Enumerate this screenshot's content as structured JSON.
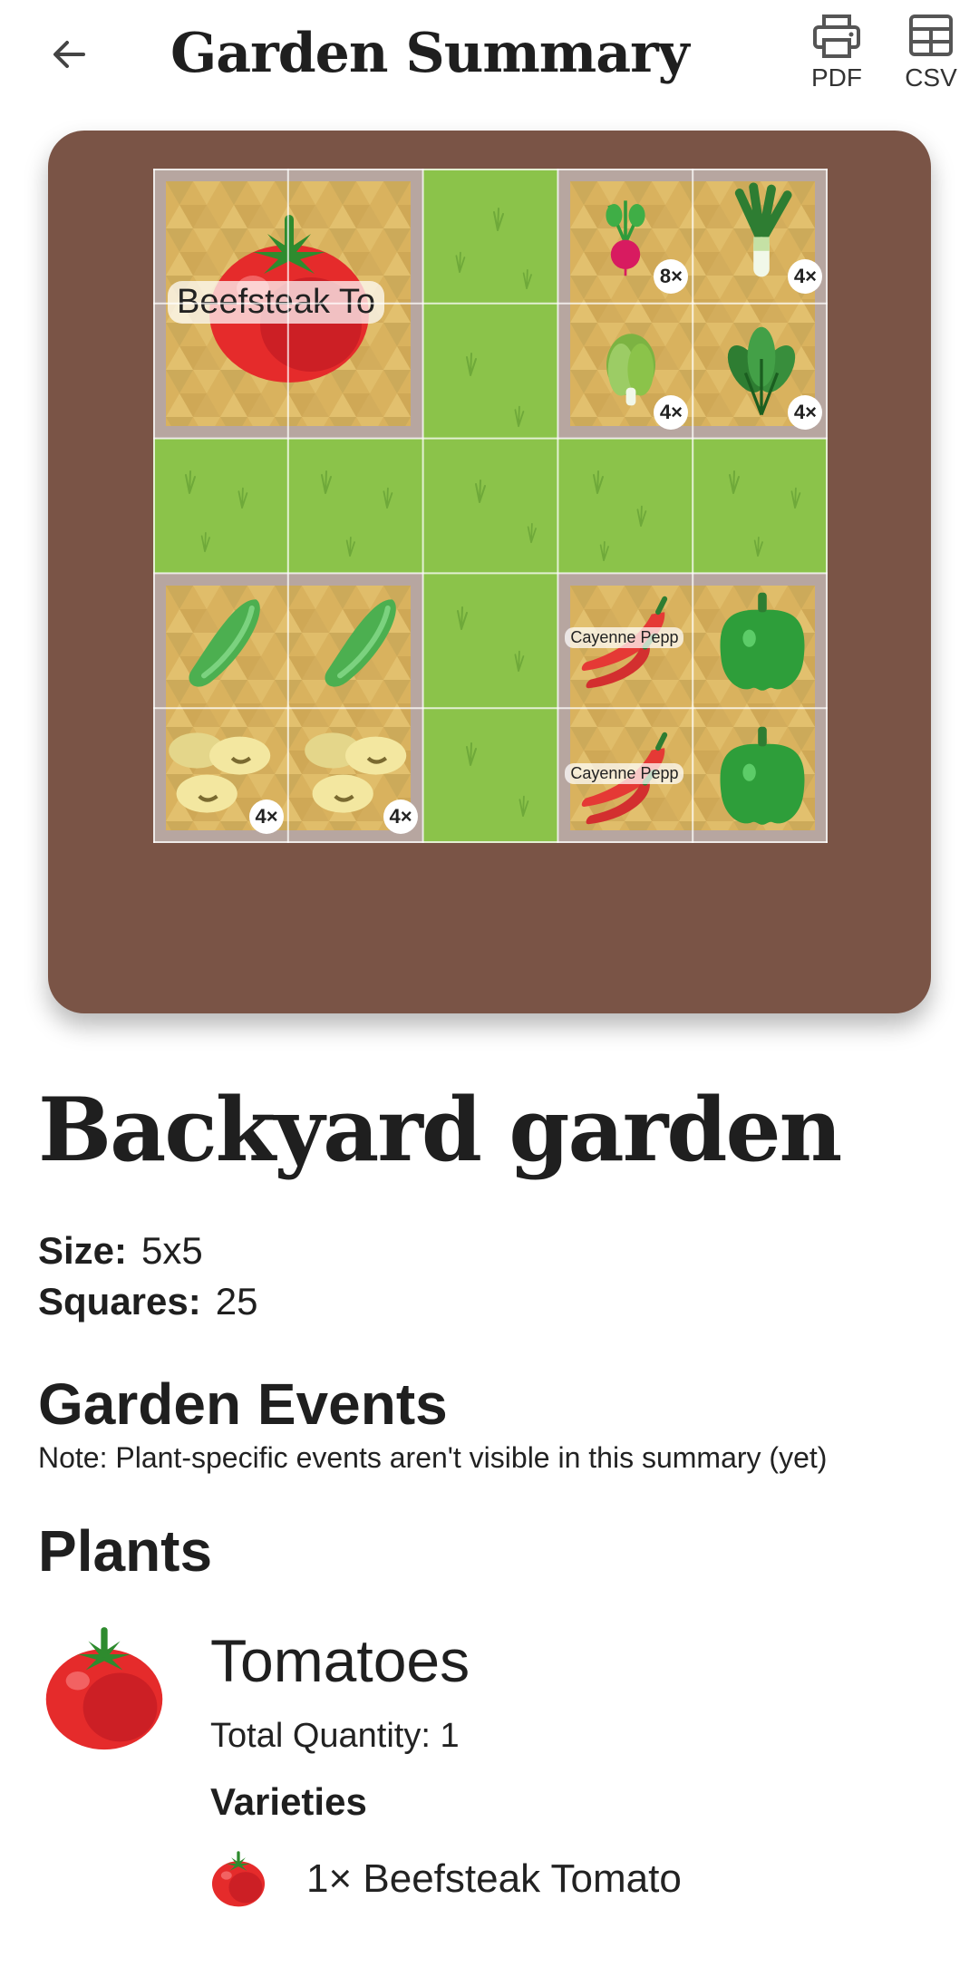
{
  "header": {
    "title": "Garden Summary",
    "back_icon": "arrow-back-icon",
    "pdf_label": "PDF",
    "csv_label": "CSV"
  },
  "garden_map": {
    "columns": 5,
    "rows": 5,
    "beds": [
      {
        "name": "top-left",
        "plants": [
          {
            "name": "Beefsteak To",
            "icon": "tomato"
          }
        ]
      },
      {
        "name": "top-right",
        "plants": [
          {
            "icon": "radish",
            "count": "8×"
          },
          {
            "icon": "leek",
            "count": "4×"
          },
          {
            "icon": "lettuce",
            "count": "4×"
          },
          {
            "icon": "spinach",
            "count": "4×"
          }
        ]
      },
      {
        "name": "bottom-left",
        "plants": [
          {
            "icon": "cucumber-beans",
            "count": "4×"
          },
          {
            "icon": "cucumber-beans",
            "count": "4×"
          }
        ]
      },
      {
        "name": "bottom-right",
        "plants": [
          {
            "name": "Cayenne Pepp",
            "icon": "chili"
          },
          {
            "icon": "bell-pepper"
          },
          {
            "name": "Cayenne Pepp",
            "icon": "chili"
          },
          {
            "icon": "bell-pepper"
          }
        ]
      }
    ],
    "colors": {
      "background": "#7a5446",
      "grass": "#8bc34a",
      "soil": "#d9b25e",
      "bed_border": "#b7a6a0"
    }
  },
  "garden": {
    "name": "Backyard garden",
    "size_label": "Size:",
    "size_value": "5x5",
    "squares_label": "Squares:",
    "squares_value": "25"
  },
  "events": {
    "title": "Garden Events",
    "note": "Note: Plant-specific events aren't visible in this summary (yet)"
  },
  "plants": {
    "title": "Plants",
    "items": [
      {
        "name": "Tomatoes",
        "icon": "tomato-icon",
        "total_quantity": "Total Quantity: 1",
        "varieties_heading": "Varieties",
        "varieties": [
          {
            "text": "1× Beefsteak Tomato",
            "icon": "tomato-icon"
          }
        ]
      }
    ]
  }
}
